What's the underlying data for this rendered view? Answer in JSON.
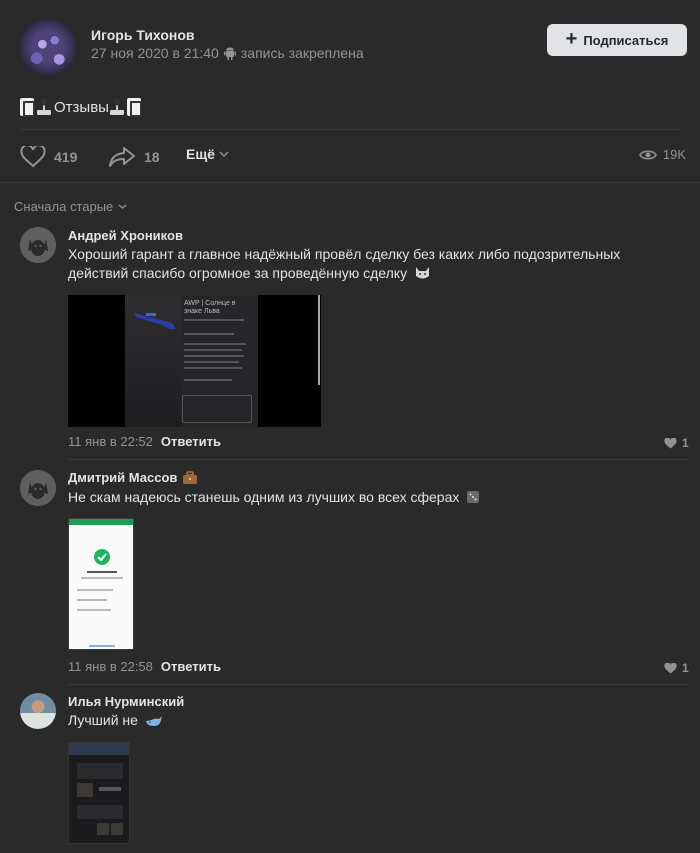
{
  "post": {
    "author_name": "Игорь Тихонов",
    "date": "27 ноя 2020 в 21:40",
    "pinned": "запись закреплена",
    "subscribe_label": "Подписаться",
    "text": "Отзывы",
    "likes": "419",
    "shares": "18",
    "more_label": "Ещё",
    "views": "19K"
  },
  "comments_sort": "Сначала старые",
  "comments": [
    {
      "author": "Андрей Хроников",
      "text": "Хороший гарант а главное надёжный провёл сделку без каких либо подозрительных действий спасибо огромное за проведённую сделку",
      "date": "11 янв в 22:52",
      "reply": "Ответить",
      "likes": "1",
      "attachment_caption": "AWP | Солнце в знаке Льва"
    },
    {
      "author": "Дмитрий Массов",
      "text": "Не скам надеюсь станешь одним из лучших во всех сферах",
      "date": "11 янв в 22:58",
      "reply": "Ответить",
      "likes": "1"
    },
    {
      "author": "Илья Нурминский",
      "text": "Лучший не"
    }
  ],
  "colors": {
    "background": "#2a2a2b",
    "text": "#e1e3e6",
    "muted": "#939393",
    "button": "#e1e3e6"
  }
}
